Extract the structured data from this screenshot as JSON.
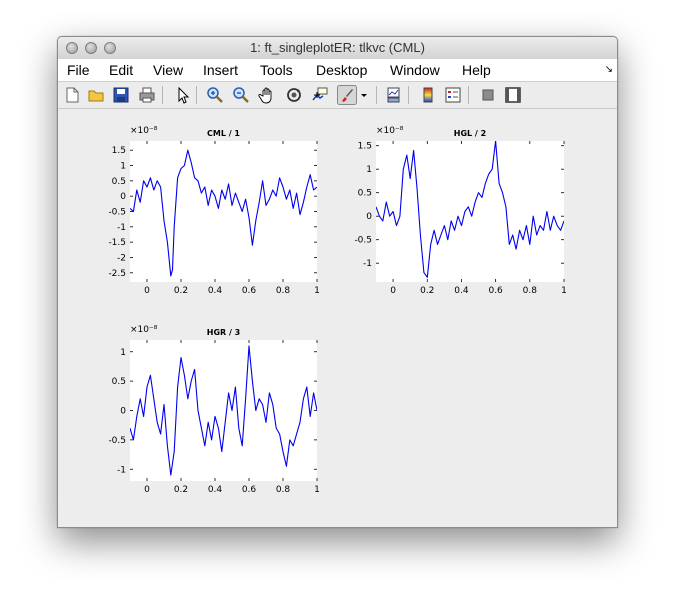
{
  "window": {
    "title": "1: ft_singleplotER: tlkvc (CML)",
    "menu": [
      "File",
      "Edit",
      "View",
      "Insert",
      "Tools",
      "Desktop",
      "Window",
      "Help"
    ],
    "menu_corner_glyph": "↘",
    "toolbar_icons": [
      "new-figure-icon",
      "open-file-icon",
      "save-icon",
      "print-icon",
      "pointer-icon",
      "zoom-in-icon",
      "zoom-out-icon",
      "pan-icon",
      "rotate-3d-icon",
      "data-cursor-icon",
      "brush-icon",
      "brush-dropdown-icon",
      "link-plot-icon",
      "colorbar-icon",
      "legend-icon",
      "hide-plot-tools-icon",
      "show-plot-tools-icon"
    ]
  },
  "colors": {
    "line": "#0000ee",
    "axes_bg": "#ffffff",
    "figure_bg": "#ededed"
  },
  "chart_data": [
    {
      "type": "line",
      "title": "CML / 1",
      "exponent_label": "×10⁻⁸",
      "xlim": [
        -0.1,
        1.0
      ],
      "ylim": [
        -2.8,
        1.8
      ],
      "xticks": [
        0,
        0.2,
        0.4,
        0.6,
        0.8,
        1
      ],
      "xtick_labels": [
        "0",
        "0.2",
        "0.4",
        "0.6",
        "0.8",
        "1"
      ],
      "yticks": [
        1.5,
        1,
        0.5,
        0,
        -0.5,
        -1,
        -1.5,
        -2,
        -2.5
      ],
      "ytick_labels": [
        "1.5",
        "1",
        "0.5",
        "0",
        "-0.5",
        "-1",
        "-1.5",
        "-2",
        "-2.5"
      ],
      "series": [
        {
          "x": [
            -0.1,
            -0.08,
            -0.06,
            -0.04,
            -0.02,
            0.0,
            0.02,
            0.04,
            0.06,
            0.08,
            0.1,
            0.12,
            0.14,
            0.15,
            0.16,
            0.18,
            0.2,
            0.22,
            0.24,
            0.26,
            0.28,
            0.3,
            0.32,
            0.34,
            0.36,
            0.38,
            0.4,
            0.42,
            0.44,
            0.46,
            0.48,
            0.5,
            0.52,
            0.54,
            0.56,
            0.58,
            0.6,
            0.62,
            0.64,
            0.66,
            0.68,
            0.7,
            0.72,
            0.74,
            0.76,
            0.78,
            0.8,
            0.82,
            0.84,
            0.86,
            0.88,
            0.9,
            0.92,
            0.94,
            0.96,
            0.98,
            1.0
          ],
          "y": [
            -0.4,
            -0.5,
            0.2,
            -0.2,
            0.5,
            0.3,
            0.6,
            0.2,
            0.5,
            0.3,
            -0.8,
            -1.5,
            -2.6,
            -2.4,
            -1.0,
            0.6,
            0.9,
            1.0,
            1.5,
            1.1,
            0.6,
            0.5,
            0.1,
            0.3,
            -0.3,
            0.2,
            0.0,
            -0.4,
            0.2,
            -0.1,
            0.4,
            -0.3,
            0.1,
            -0.2,
            -0.5,
            -0.1,
            -0.7,
            -1.6,
            -0.8,
            -0.2,
            0.5,
            -0.3,
            -0.1,
            0.2,
            0.0,
            0.6,
            0.3,
            -0.1,
            0.2,
            -0.4,
            0.1,
            -0.6,
            -0.2,
            0.3,
            0.7,
            0.2,
            0.3
          ]
        }
      ]
    },
    {
      "type": "line",
      "title": "HGL / 2",
      "exponent_label": "×10⁻⁸",
      "xlim": [
        -0.1,
        1.0
      ],
      "ylim": [
        -1.4,
        1.6
      ],
      "xticks": [
        0,
        0.2,
        0.4,
        0.6,
        0.8,
        1
      ],
      "xtick_labels": [
        "0",
        "0.2",
        "0.4",
        "0.6",
        "0.8",
        "1"
      ],
      "yticks": [
        1.5,
        1,
        0.5,
        0,
        -0.5,
        -1
      ],
      "ytick_labels": [
        "1.5",
        "1",
        "0.5",
        "0",
        "-0.5",
        "-1"
      ],
      "series": [
        {
          "x": [
            -0.1,
            -0.08,
            -0.06,
            -0.04,
            -0.02,
            0.0,
            0.02,
            0.04,
            0.06,
            0.08,
            0.1,
            0.12,
            0.14,
            0.16,
            0.18,
            0.2,
            0.22,
            0.24,
            0.26,
            0.28,
            0.3,
            0.32,
            0.34,
            0.36,
            0.38,
            0.4,
            0.42,
            0.44,
            0.46,
            0.48,
            0.5,
            0.52,
            0.54,
            0.56,
            0.58,
            0.6,
            0.62,
            0.64,
            0.66,
            0.68,
            0.7,
            0.72,
            0.74,
            0.76,
            0.78,
            0.8,
            0.82,
            0.84,
            0.86,
            0.88,
            0.9,
            0.92,
            0.94,
            0.96,
            0.98,
            1.0
          ],
          "y": [
            0.2,
            0.0,
            -0.1,
            0.3,
            0.0,
            0.1,
            -0.2,
            0.0,
            1.0,
            1.3,
            0.8,
            1.4,
            0.6,
            -0.4,
            -1.2,
            -1.3,
            -0.6,
            -0.3,
            -0.6,
            -0.4,
            -0.2,
            -0.5,
            -0.1,
            -0.3,
            0.0,
            -0.2,
            0.1,
            0.2,
            0.0,
            0.3,
            0.5,
            0.4,
            0.7,
            0.9,
            1.0,
            1.6,
            0.7,
            0.5,
            0.2,
            -0.6,
            -0.4,
            -0.7,
            -0.3,
            -0.5,
            -0.2,
            -0.6,
            0.0,
            -0.4,
            -0.2,
            -0.3,
            0.1,
            -0.3,
            0.0,
            -0.2,
            -0.3,
            -0.1
          ]
        }
      ]
    },
    {
      "type": "line",
      "title": "HGR / 3",
      "exponent_label": "×10⁻⁸",
      "xlim": [
        -0.1,
        1.0
      ],
      "ylim": [
        -1.2,
        1.2
      ],
      "xticks": [
        0,
        0.2,
        0.4,
        0.6,
        0.8,
        1
      ],
      "xtick_labels": [
        "0",
        "0.2",
        "0.4",
        "0.6",
        "0.8",
        "1"
      ],
      "yticks": [
        1,
        0.5,
        0,
        -0.5,
        -1
      ],
      "ytick_labels": [
        "1",
        "0.5",
        "0",
        "-0.5",
        "-1"
      ],
      "series": [
        {
          "x": [
            -0.1,
            -0.08,
            -0.06,
            -0.04,
            -0.02,
            0.0,
            0.02,
            0.04,
            0.06,
            0.08,
            0.1,
            0.12,
            0.14,
            0.16,
            0.18,
            0.2,
            0.22,
            0.24,
            0.26,
            0.28,
            0.3,
            0.32,
            0.34,
            0.36,
            0.38,
            0.4,
            0.42,
            0.44,
            0.46,
            0.48,
            0.5,
            0.52,
            0.54,
            0.56,
            0.58,
            0.6,
            0.62,
            0.64,
            0.66,
            0.68,
            0.7,
            0.72,
            0.74,
            0.76,
            0.78,
            0.8,
            0.82,
            0.84,
            0.86,
            0.88,
            0.9,
            0.92,
            0.94,
            0.96,
            0.98,
            1.0
          ],
          "y": [
            -0.3,
            -0.5,
            -0.1,
            0.2,
            -0.1,
            0.4,
            0.6,
            0.2,
            -0.2,
            -0.4,
            0.1,
            -0.6,
            -1.1,
            -0.7,
            0.4,
            0.9,
            0.6,
            0.2,
            0.5,
            0.7,
            0.0,
            -0.3,
            -0.6,
            -0.2,
            -0.5,
            -0.1,
            -0.3,
            -0.7,
            -0.2,
            0.3,
            0.0,
            0.4,
            -0.3,
            -0.6,
            0.2,
            1.1,
            0.5,
            0.0,
            0.2,
            0.1,
            -0.2,
            0.3,
            0.1,
            -0.3,
            -0.4,
            -0.7,
            -0.95,
            -0.5,
            -0.6,
            -0.4,
            -0.2,
            0.2,
            0.4,
            -0.1,
            0.3,
            0.0
          ]
        }
      ]
    }
  ]
}
